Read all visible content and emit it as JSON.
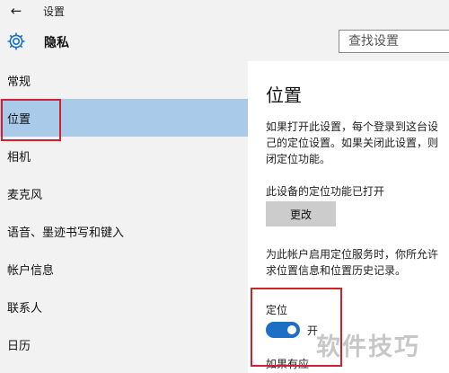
{
  "window": {
    "title": "设置",
    "back_icon": "back-arrow-icon"
  },
  "header": {
    "title": "隐私",
    "icon": "gear-icon",
    "search_placeholder": "查找设置"
  },
  "sidebar": {
    "items": [
      {
        "label": "常规"
      },
      {
        "label": "位置",
        "selected": true
      },
      {
        "label": "相机"
      },
      {
        "label": "麦克风"
      },
      {
        "label": "语音、墨迹书写和键入"
      },
      {
        "label": "帐户信息"
      },
      {
        "label": "联系人"
      },
      {
        "label": "日历"
      }
    ]
  },
  "main": {
    "title": "位置",
    "description": "如果打开此设置，每个登录到这台设\n己的定位设置。如果关闭此设置，则\n闭定位功能。",
    "device_status": "此设备的定位功能已打开",
    "change_button": "更改",
    "account_description": "为此帐户启用定位服务时，你所允许\n求位置信息和位置历史记录。",
    "location_label": "定位",
    "toggle": {
      "on": true,
      "state_label": "开"
    },
    "bottom_text": "如果有应"
  },
  "watermark": "软件技巧",
  "colors": {
    "selected_bg": "#a9cbe9",
    "highlight_box": "#d0212e",
    "toggle_on": "#1c6fc4",
    "sidebar_bg": "#f2f2f2"
  }
}
